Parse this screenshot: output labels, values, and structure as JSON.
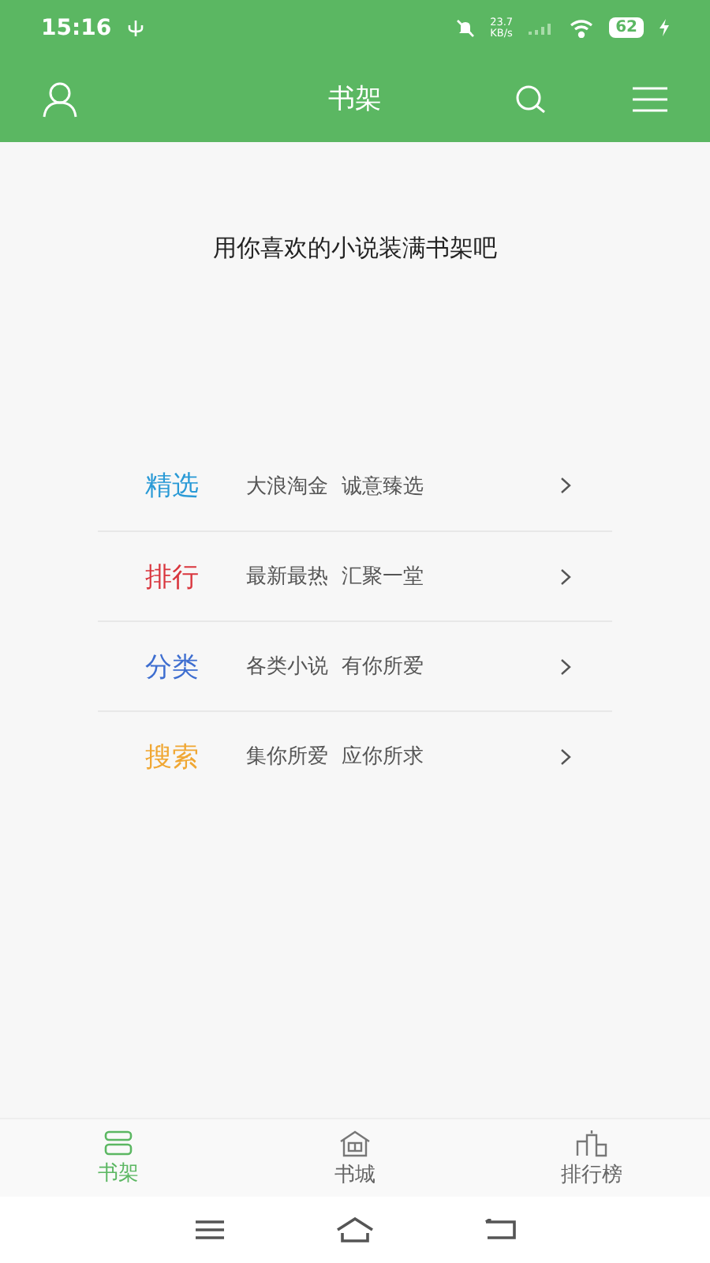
{
  "status_bar": {
    "time": "15:16",
    "speed_value": "23.7",
    "speed_unit": "KB/s",
    "battery": "62"
  },
  "header": {
    "title": "书架"
  },
  "empty_message": "用你喜欢的小说装满书架吧",
  "menu": [
    {
      "title": "精选",
      "subtitle": "大浪淘金  诚意臻选",
      "color": "#2a9ad6"
    },
    {
      "title": "排行",
      "subtitle": "最新最热  汇聚一堂",
      "color": "#d9363e"
    },
    {
      "title": "分类",
      "subtitle": "各类小说  有你所爱",
      "color": "#3e6ed0"
    },
    {
      "title": "搜索",
      "subtitle": "集你所爱  应你所求",
      "color": "#f0a733"
    }
  ],
  "tabs": [
    {
      "label": "书架",
      "selected": true,
      "kind": "shelf"
    },
    {
      "label": "书城",
      "selected": false,
      "kind": "store"
    },
    {
      "label": "排行榜",
      "selected": false,
      "kind": "rank"
    }
  ]
}
